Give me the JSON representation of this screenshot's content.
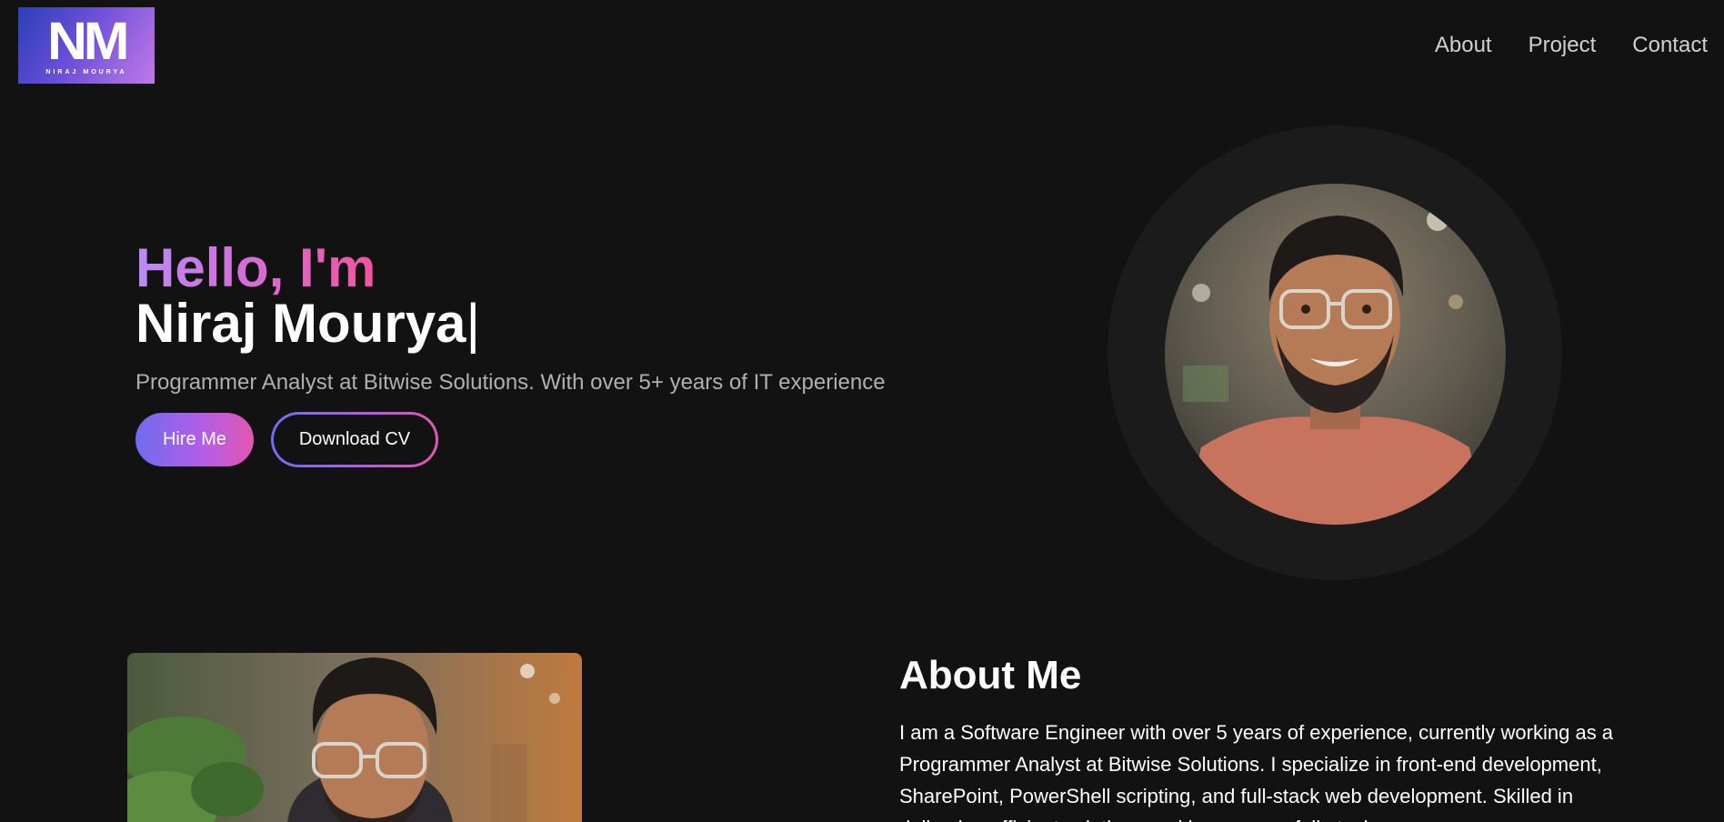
{
  "header": {
    "logo": {
      "mark": "NM",
      "subtitle": "NIRAJ MOURYA"
    },
    "nav": [
      {
        "label": "About"
      },
      {
        "label": "Project"
      },
      {
        "label": "Contact"
      }
    ]
  },
  "hero": {
    "greeting": "Hello, I'm",
    "name": "Niraj Mourya",
    "cursor": "|",
    "subtitle": "Programmer Analyst at Bitwise Solutions. With over 5+ years of IT experience",
    "hire_label": "Hire Me",
    "cv_label": "Download CV"
  },
  "about": {
    "title": "About Me",
    "text": "I am a Software Engineer with over 5 years of experience, currently working as a Programmer Analyst at Bitwise Solutions. I specialize in front-end development, SharePoint, PowerShell scripting, and full-stack web development. Skilled in delivering efficient solutions and known as a full-stack"
  },
  "colors": {
    "background": "#121212",
    "accent_start": "#6f6cf0",
    "accent_mid": "#b15ee6",
    "accent_end": "#e256b0",
    "ring": "#1b1b1b"
  }
}
